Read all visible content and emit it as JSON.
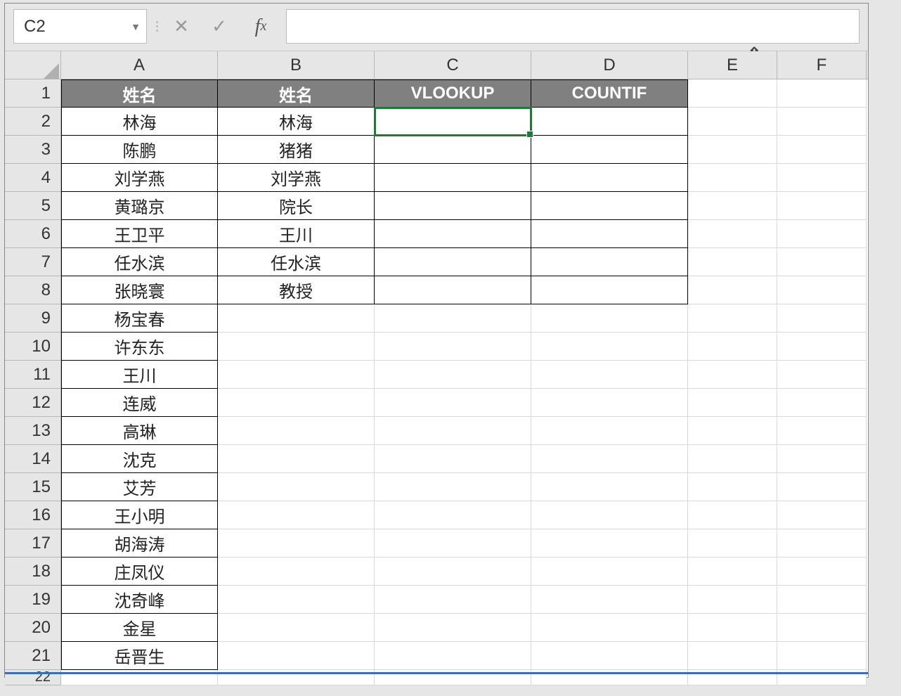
{
  "formula_bar": {
    "name_box": "C2",
    "formula": ""
  },
  "columns": [
    "A",
    "B",
    "C",
    "D",
    "E",
    "F"
  ],
  "row_count": 22,
  "headers": {
    "A": "姓名",
    "B": "姓名",
    "C": "VLOOKUP",
    "D": "COUNTIF"
  },
  "col_a": [
    "林海",
    "陈鹏",
    "刘学燕",
    "黄璐京",
    "王卫平",
    "任水滨",
    "张晓寰",
    "杨宝春",
    "许东东",
    "王川",
    "连威",
    "高琳",
    "沈克",
    "艾芳",
    "王小明",
    "胡海涛",
    "庄凤仪",
    "沈奇峰",
    "金星",
    "岳晋生"
  ],
  "col_b": [
    "林海",
    "猪猪",
    "刘学燕",
    "院长",
    "王川",
    "任水滨",
    "教授"
  ],
  "active_cell": "C2"
}
